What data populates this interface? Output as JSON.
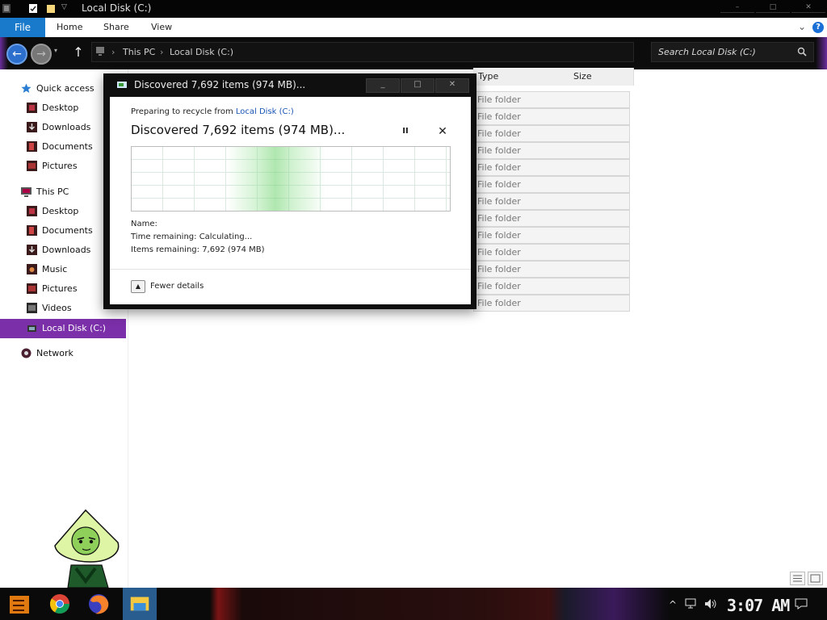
{
  "window": {
    "title": "Local Disk (C:)",
    "minimize": "–",
    "maximize": "□",
    "close": "✕"
  },
  "ribbon": {
    "tabs": [
      "File",
      "Home",
      "Share",
      "View"
    ],
    "help": "?",
    "collapse": "⌄"
  },
  "nav_buttons": {
    "back": "←",
    "forward": "→",
    "up": "↑"
  },
  "address": {
    "crumbs": [
      "This PC",
      "Local Disk (C:)"
    ],
    "separator": "›"
  },
  "search": {
    "placeholder": "Search Local Disk (C:)",
    "icon": "search-icon"
  },
  "nav_pane": {
    "quick_access": {
      "label": "Quick access",
      "items": [
        "Desktop",
        "Downloads",
        "Documents",
        "Pictures"
      ]
    },
    "this_pc": {
      "label": "This PC",
      "items": [
        "Desktop",
        "Documents",
        "Downloads",
        "Music",
        "Pictures",
        "Videos",
        "Local Disk (C:)"
      ]
    },
    "network": "Network",
    "selected": "Local Disk (C:)"
  },
  "file_list": {
    "columns": [
      "Type",
      "Size"
    ],
    "type_values": [
      "File folder",
      "File folder",
      "File folder",
      "File folder",
      "File folder",
      "File folder",
      "File folder",
      "File folder",
      "File folder",
      "File folder",
      "File folder",
      "File folder",
      "File folder"
    ]
  },
  "dialog": {
    "title": "Discovered 7,692 items (974 MB)...",
    "prep_prefix": "Preparing to recycle from ",
    "prep_location": "Local Disk (C:)",
    "heading": "Discovered 7,692 items (974 MB)...",
    "pause": "II",
    "cancel": "✕",
    "name_label": "Name:",
    "time_remaining": "Time remaining: Calculating...",
    "items_remaining": "Items remaining: 7,692 (974 MB)",
    "fewer_details": "Fewer details",
    "fewer_icon": "▲",
    "minimize": "_",
    "maximize": "□",
    "close": "✕"
  },
  "taskbar": {
    "apps": [
      "start-icon",
      "chrome-icon",
      "firefox-icon",
      "file-explorer-icon"
    ],
    "clock": "3:07 AM",
    "tray_chevron": "^",
    "tray_network": "network-icon",
    "tray_volume": "volume-icon",
    "notifications": "notifications-icon"
  },
  "colors": {
    "accent": "#7b2fa8",
    "file_tab": "#1979ca",
    "titlebar": "#050505"
  }
}
